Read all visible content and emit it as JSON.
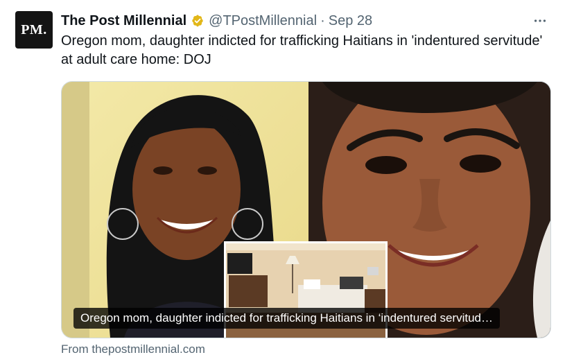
{
  "tweet": {
    "avatar_text": "PM.",
    "display_name": "The Post Millennial",
    "verified_badge": "gold-verified-icon",
    "handle": "@TPostMillennial",
    "separator": "·",
    "date": "Sep 28",
    "more_icon": "more-horizontal-icon",
    "text": "Oregon mom, daughter indicted for trafficking Haitians in 'indentured servitude' at adult care home: DOJ"
  },
  "card": {
    "caption": "Oregon mom, daughter indicted for trafficking Haitians in ‘indentured servitud…",
    "source": "From thepostmillennial.com"
  },
  "colors": {
    "text_primary": "#0f1419",
    "text_secondary": "#536471",
    "border": "#cfd9de",
    "verified_gold": "#e2b719"
  }
}
